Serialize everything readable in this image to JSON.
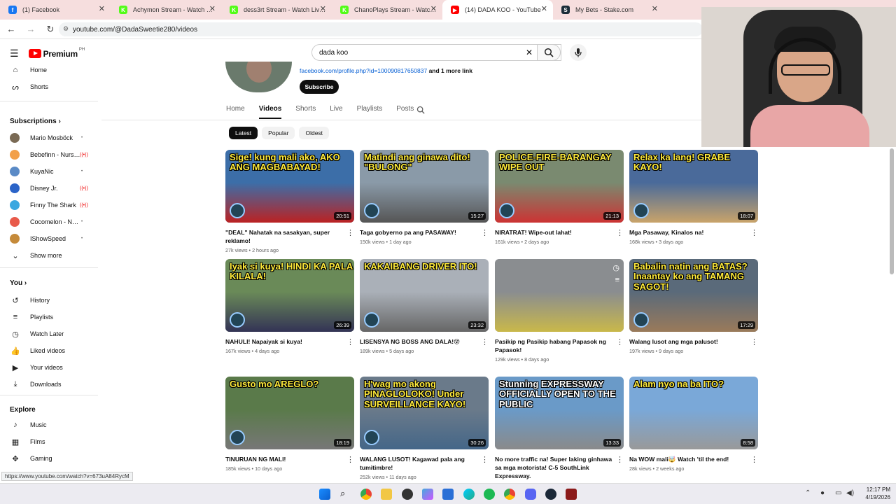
{
  "browser": {
    "tabs": [
      {
        "title": "(1) Facebook",
        "color": "#1877f2",
        "glyph": "f"
      },
      {
        "title": "Achymon Stream - Watch Live on Kick",
        "color": "#53fc18",
        "glyph": "K"
      },
      {
        "title": "dess3rt Stream - Watch Live on Kick",
        "color": "#53fc18",
        "glyph": "K"
      },
      {
        "title": "ChanoPlays Stream - Watch Live on Kick",
        "color": "#53fc18",
        "glyph": "K"
      },
      {
        "title": "(14) DADA KOO - YouTube",
        "color": "#ff0000",
        "glyph": "▶"
      },
      {
        "title": "My Bets - Stake.com",
        "color": "#1a2c38",
        "glyph": "S"
      }
    ],
    "url": "youtube.com/@DadaSweetie280/videos",
    "status_url": "https://www.youtube.com/watch?v=673uA84RycM"
  },
  "yt": {
    "brand": "Premium",
    "region": "PH",
    "search_value": "dada koo"
  },
  "sidebar": {
    "main": [
      {
        "label": "Home",
        "icon": "⌂",
        "name": "sidebar-item-home"
      },
      {
        "label": "Shorts",
        "icon": "ᔕ",
        "name": "sidebar-item-shorts"
      }
    ],
    "subscriptions_title": "Subscriptions",
    "subscriptions": [
      {
        "label": "Mario Mosböck",
        "status": "•",
        "color": "#7a6a55"
      },
      {
        "label": "Bebefinn - Nursery Rhymes",
        "status": "((•))",
        "color": "#f2a04a"
      },
      {
        "label": "KuyaNic",
        "status": "•",
        "color": "#5a8ac6"
      },
      {
        "label": "Disney Jr.",
        "status": "((•))",
        "color": "#2b64c8"
      },
      {
        "label": "Finny The Shark",
        "status": "((•))",
        "color": "#3aa7e0"
      },
      {
        "label": "Cocomelon - Nursery Rhymes",
        "status": "•",
        "color": "#e85a4a"
      },
      {
        "label": "IShowSpeed",
        "status": "•",
        "color": "#c58a3a"
      }
    ],
    "show_more": "Show more",
    "you_title": "You",
    "you": [
      {
        "label": "History",
        "icon": "↺"
      },
      {
        "label": "Playlists",
        "icon": "≡"
      },
      {
        "label": "Watch Later",
        "icon": "◷"
      },
      {
        "label": "Liked videos",
        "icon": "👍"
      },
      {
        "label": "Your videos",
        "icon": "▶"
      },
      {
        "label": "Downloads",
        "icon": "⤓"
      }
    ],
    "explore_title": "Explore",
    "explore": [
      {
        "label": "Music",
        "icon": "♪"
      },
      {
        "label": "Films",
        "icon": "▦"
      },
      {
        "label": "Gaming",
        "icon": "✥"
      }
    ]
  },
  "channel": {
    "link": "facebook.com/profile.php?id=100090817650837",
    "more_links": "and 1 more link",
    "subscribe": "Subscribe",
    "tabs": [
      "Home",
      "Videos",
      "Shorts",
      "Live",
      "Playlists",
      "Posts"
    ],
    "active_tab": "Videos",
    "chips": [
      "Latest",
      "Popular",
      "Oldest"
    ]
  },
  "videos": [
    {
      "title": "\"DEAL\" Nahatak na sasakyan, super reklamo!",
      "meta": "27k views • 2 hours ago",
      "duration": "20:51",
      "overlay": "Sige! kung mali ako, AKO ANG MAGBABAYAD!",
      "bg": "#3c6ea8",
      "scene": "#b22",
      "ovc": "#ffeb3b"
    },
    {
      "title": "Taga gobyerno pa ang PASAWAY!",
      "meta": "150k views • 1 day ago",
      "duration": "15:27",
      "overlay": "Matindi ang ginawa dito! \"BULONG\"",
      "bg": "#8a9aa8",
      "scene": "#555",
      "ovc": "#ffeb3b"
    },
    {
      "title": "NIRATRAT! Wipe-out lahat!",
      "meta": "161k views • 2 days ago",
      "duration": "21:13",
      "overlay": "POLICE-FIRE-BARANGAY WIPE OUT",
      "bg": "#7a8a70",
      "scene": "#c33",
      "ovc": "#ffeb3b"
    },
    {
      "title": "Mga Pasaway, Kinalos na!",
      "meta": "168k views • 3 days ago",
      "duration": "18:07",
      "overlay": "Relax ka lang! GRABE KAYO!",
      "bg": "#4a6a9a",
      "scene": "#c9a36a",
      "ovc": "#ffeb3b"
    },
    {
      "title": "NAHULI! Napaiyak si kuya!",
      "meta": "167k views • 4 days ago",
      "duration": "26:39",
      "overlay": "Iyak si kuya! HINDI KA PALA KILALA!",
      "bg": "#6a8a58",
      "scene": "#335",
      "ovc": "#ffeb3b"
    },
    {
      "title": "LISENSYA NG BOSS ANG DALA!😵",
      "meta": "189k views • 5 days ago",
      "duration": "23:32",
      "overlay": "KAKAIBANG DRIVER ITO!",
      "bg": "#aab0b8",
      "scene": "#666",
      "ovc": "#ffeb3b"
    },
    {
      "title": "Pasikip ng Pasikip habang Papasok ng Papasok!",
      "meta": "129k views • 8 days ago",
      "duration": "",
      "overlay": "",
      "bg": "#8a8d90",
      "scene": "#c9b84a",
      "ovc": "#ffeb3b"
    },
    {
      "title": "Walang lusot ang mga palusot!",
      "meta": "197k views • 9 days ago",
      "duration": "17:29",
      "overlay": "Babalin natin ang BATAS? Inaantay ko ang TAMANG SAGOT!",
      "bg": "#5a6a7a",
      "scene": "#9a7a5a",
      "ovc": "#ffeb3b"
    },
    {
      "title": "TINURUAN NG MALI!",
      "meta": "185k views • 10 days ago",
      "duration": "18:19",
      "overlay": "Gusto mo AREGLO?",
      "bg": "#5a7a4a",
      "scene": "#777",
      "ovc": "#ffeb3b"
    },
    {
      "title": "WALANG LUSOT! Kagawad pala ang tumitimbre!",
      "meta": "252k views • 11 days ago",
      "duration": "30:26",
      "overlay": "H'wag mo akong PINAGLOLOKO! Under SURVEILLANCE KAYO!",
      "bg": "#6a7a8a",
      "scene": "#468",
      "ovc": "#ffeb3b"
    },
    {
      "title": "No more traffic na! Super laking ginhawa sa mga motorista! C-5 SouthLink Expressway.",
      "meta": "168k views • 2 weeks ago",
      "duration": "13:33",
      "overlay": "Stunning EXPRESSWAY  OFFICIALLY OPEN TO THE PUBLIC",
      "bg": "#6a9ac8",
      "scene": "#8a8a8a",
      "ovc": "#ffffff"
    },
    {
      "title": "Na WOW mali🤯 Watch 'til the end!",
      "meta": "28k views • 2 weeks ago",
      "duration": "8:58",
      "overlay": "Alam nyo na ba ITO?",
      "bg": "#7aa8d8",
      "scene": "#999",
      "ovc": "#ffeb3b"
    }
  ],
  "taskbar": {
    "time": "12:17 PM",
    "date": "4/19/2026"
  }
}
